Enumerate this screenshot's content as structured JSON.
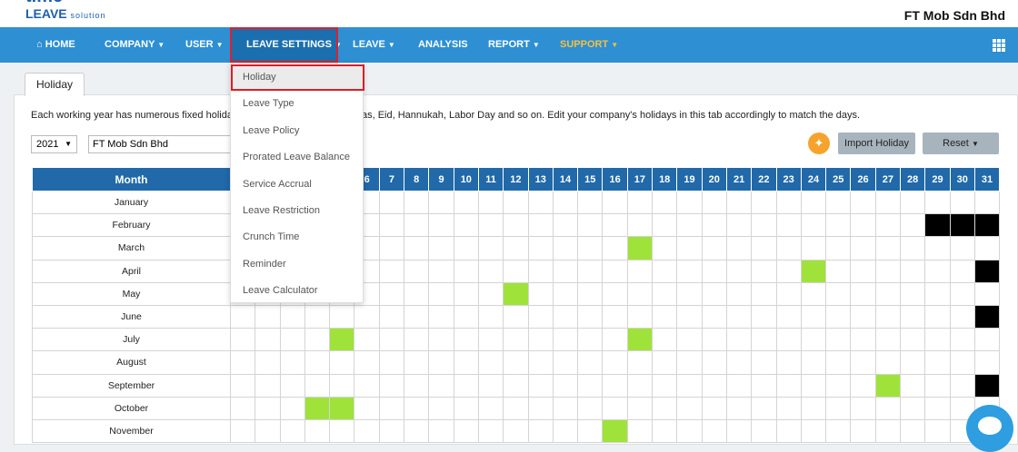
{
  "header": {
    "logo_top": "time",
    "logo_main": "LEAVE",
    "logo_sub": "solution",
    "company": "FT Mob Sdn Bhd"
  },
  "nav": {
    "home": "HOME",
    "company": "COMPANY",
    "user": "USER",
    "leave_settings": "LEAVE SETTINGS",
    "leave": "LEAVE",
    "analysis": "ANALYSIS",
    "report": "REPORT",
    "support": "SUPPORT"
  },
  "tab": {
    "label": "Holiday"
  },
  "description": {
    "left": "Each working year has numerous fixed holida",
    "right": "as, Eid, Hannukah, Labor Day and so on. Edit your company's holidays in this tab accordingly to match the days."
  },
  "filters": {
    "year": "2021",
    "company": "FT Mob Sdn Bhd"
  },
  "buttons": {
    "import": "Import Holiday",
    "reset": "Reset"
  },
  "dropdown": {
    "items": [
      "Holiday",
      "Leave Type",
      "Leave Policy",
      "Prorated Leave Balance",
      "Service Accrual",
      "Leave Restriction",
      "Crunch Time",
      "Reminder",
      "Leave Calculator"
    ]
  },
  "calendar": {
    "month_header": "Month",
    "days": [
      "1",
      "2",
      "3",
      "4",
      "5",
      "6",
      "7",
      "8",
      "9",
      "10",
      "11",
      "12",
      "13",
      "14",
      "15",
      "16",
      "17",
      "18",
      "19",
      "20",
      "21",
      "22",
      "23",
      "24",
      "25",
      "26",
      "27",
      "28",
      "29",
      "30",
      "31"
    ],
    "months": [
      "January",
      "February",
      "March",
      "April",
      "May",
      "June",
      "July",
      "August",
      "September",
      "October",
      "November"
    ],
    "holidays": [
      {
        "month": 2,
        "day": 17
      },
      {
        "month": 3,
        "day": 24
      },
      {
        "month": 4,
        "day": 12
      },
      {
        "month": 6,
        "day": 5
      },
      {
        "month": 6,
        "day": 17
      },
      {
        "month": 8,
        "day": 27
      },
      {
        "month": 9,
        "day": 4
      },
      {
        "month": 9,
        "day": 5
      },
      {
        "month": 10,
        "day": 16
      }
    ],
    "invalid_days": [
      {
        "month": 1,
        "day": 29
      },
      {
        "month": 1,
        "day": 30
      },
      {
        "month": 1,
        "day": 31
      },
      {
        "month": 3,
        "day": 31
      },
      {
        "month": 5,
        "day": 31
      },
      {
        "month": 8,
        "day": 31
      }
    ],
    "colors": {
      "holiday": "#9fe33a",
      "invalid": "#000000"
    }
  }
}
